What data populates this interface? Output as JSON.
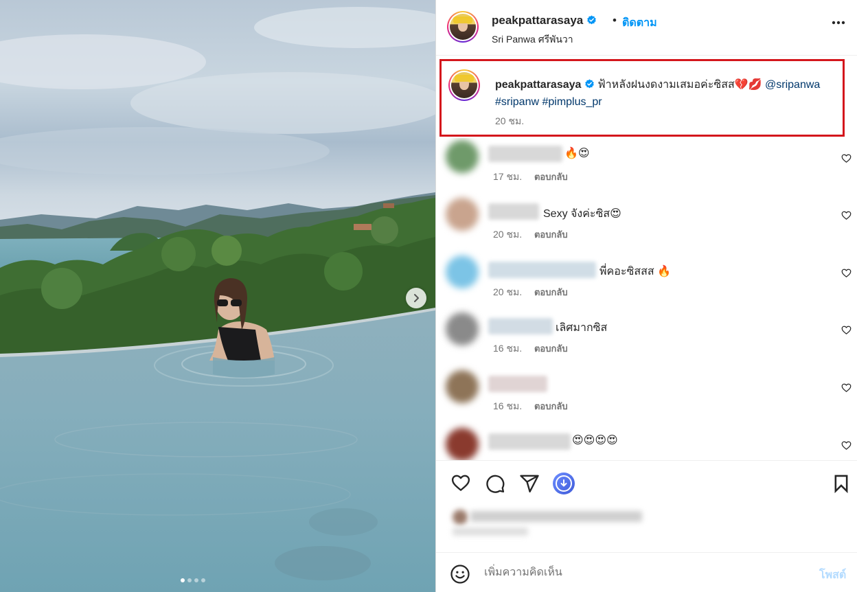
{
  "post": {
    "username": "peakpattarasaya",
    "separator": "•",
    "follow_label": "ติดตาม",
    "location": "Sri Panwa ศรีพันวา",
    "more_icon": "more-horizontal-icon"
  },
  "caption": {
    "username": "peakpattarasaya",
    "text": "ฟ้าหลังฝนงดงามเสมอค่ะซิสส💔💋 ",
    "mention": "@sripanwa",
    "hashtags": "#sripanw #pimplus_pr",
    "time": "20 ชม."
  },
  "comments": [
    {
      "text": "🔥😍",
      "time": "17 ชม.",
      "reply": "ตอบกลับ"
    },
    {
      "text": "Sexy จังค่ะซิส😍",
      "time": "20 ชม.",
      "reply": "ตอบกลับ"
    },
    {
      "text": "พี่คอะซิสสส 🔥",
      "time": "20 ชม.",
      "reply": "ตอบกลับ"
    },
    {
      "text": "เลิศมากซิส",
      "time": "16 ชม.",
      "reply": "ตอบกลับ"
    },
    {
      "text": "",
      "time": "16 ชม.",
      "reply": "ตอบกลับ"
    },
    {
      "text": "😍😍😍😍",
      "time": "",
      "reply": ""
    }
  ],
  "composer": {
    "placeholder": "เพิ่มความคิดเห็น",
    "post_label": "โพสต์"
  },
  "carousel": {
    "slide_count": 4,
    "active_index": 0
  },
  "colors": {
    "accent": "#0095f6",
    "highlight_border": "#d4161c",
    "secondary_text": "#737373"
  }
}
